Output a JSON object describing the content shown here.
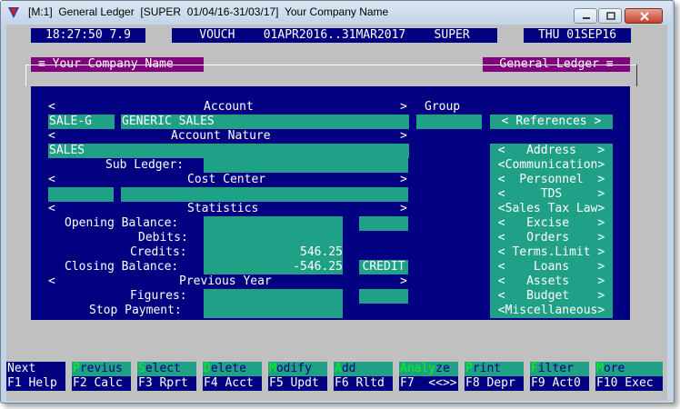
{
  "window": {
    "title": "[M:1]  General Ledger  [SUPER  01/04/16-31/03/17]  Your Company Name",
    "controls": [
      "minimize",
      "maximize",
      "close"
    ]
  },
  "statusbar": {
    "time": "18:27:50 7.9",
    "center": "VOUCH    01APR2016..31MAR2017    SUPER",
    "date": "THU 01SEP16"
  },
  "panel": {
    "left_title": "≡ Your Company Name",
    "right_title": "General Ledger ≡"
  },
  "form": {
    "account_header": "Account",
    "group_header": "Group",
    "account_code": "SALE-G",
    "account_name": "GENERIC SALES",
    "group_value": "",
    "nature_header": "Account Nature",
    "nature_value": "SALES",
    "sub_ledger_label": "Sub Ledger:",
    "sub_ledger_value": "",
    "cost_center_header": "Cost Center",
    "cost_center_code": "",
    "cost_center_name": "",
    "statistics_header": "Statistics",
    "opening_label": "Opening Balance:",
    "opening_value": "",
    "debits_label": "Debits:",
    "debits_value": "",
    "credits_label": "Credits:",
    "credits_value": "546.25",
    "closing_label": "Closing Balance:",
    "closing_value": "-546.25",
    "closing_type": "CREDIT",
    "previous_year_header": "Previous Year",
    "figures_label": "Figures:",
    "figures_value": "",
    "stop_payment_label": "Stop Payment:",
    "stop_payment_value": "",
    "lt": "<",
    "gt": ">"
  },
  "side_menu": [
    "< References >",
    "<   Address   >",
    "<Communication>",
    "<  Personnel  >",
    "<     TDS     >",
    "<Sales Tax Law>",
    "<   Excise    >",
    "<   Orders    >",
    "< Terms.Limit >",
    "<    Loans    >",
    "<   Assets    >",
    "<   Budget    >",
    "<Miscellaneous>"
  ],
  "function_keys": {
    "top": [
      {
        "hot": "",
        "rest": "Next"
      },
      {
        "hot": "P",
        "rest": "revius"
      },
      {
        "hot": "S",
        "rest": "elect"
      },
      {
        "hot": "D",
        "rest": "elete"
      },
      {
        "hot": "M",
        "rest": "odify"
      },
      {
        "hot": "A",
        "rest": "dd"
      },
      {
        "hot": "Analy",
        "rest": "ze",
        "hot_first": true
      },
      {
        "hot": "P",
        "rest": "rint",
        "pre": "",
        "mid": "r"
      },
      {
        "hot": "F",
        "rest": "ilter"
      },
      {
        "hot": "M",
        "rest": "ore"
      }
    ],
    "bottom": [
      "F1 Help",
      "F2 Calc",
      "F3 Rprt",
      "F4 Acct",
      "F5 Updt",
      "F6 Rltd",
      "F7  <<>>",
      "F8 Depr",
      "F9 Act0",
      "F10 Exec"
    ]
  }
}
